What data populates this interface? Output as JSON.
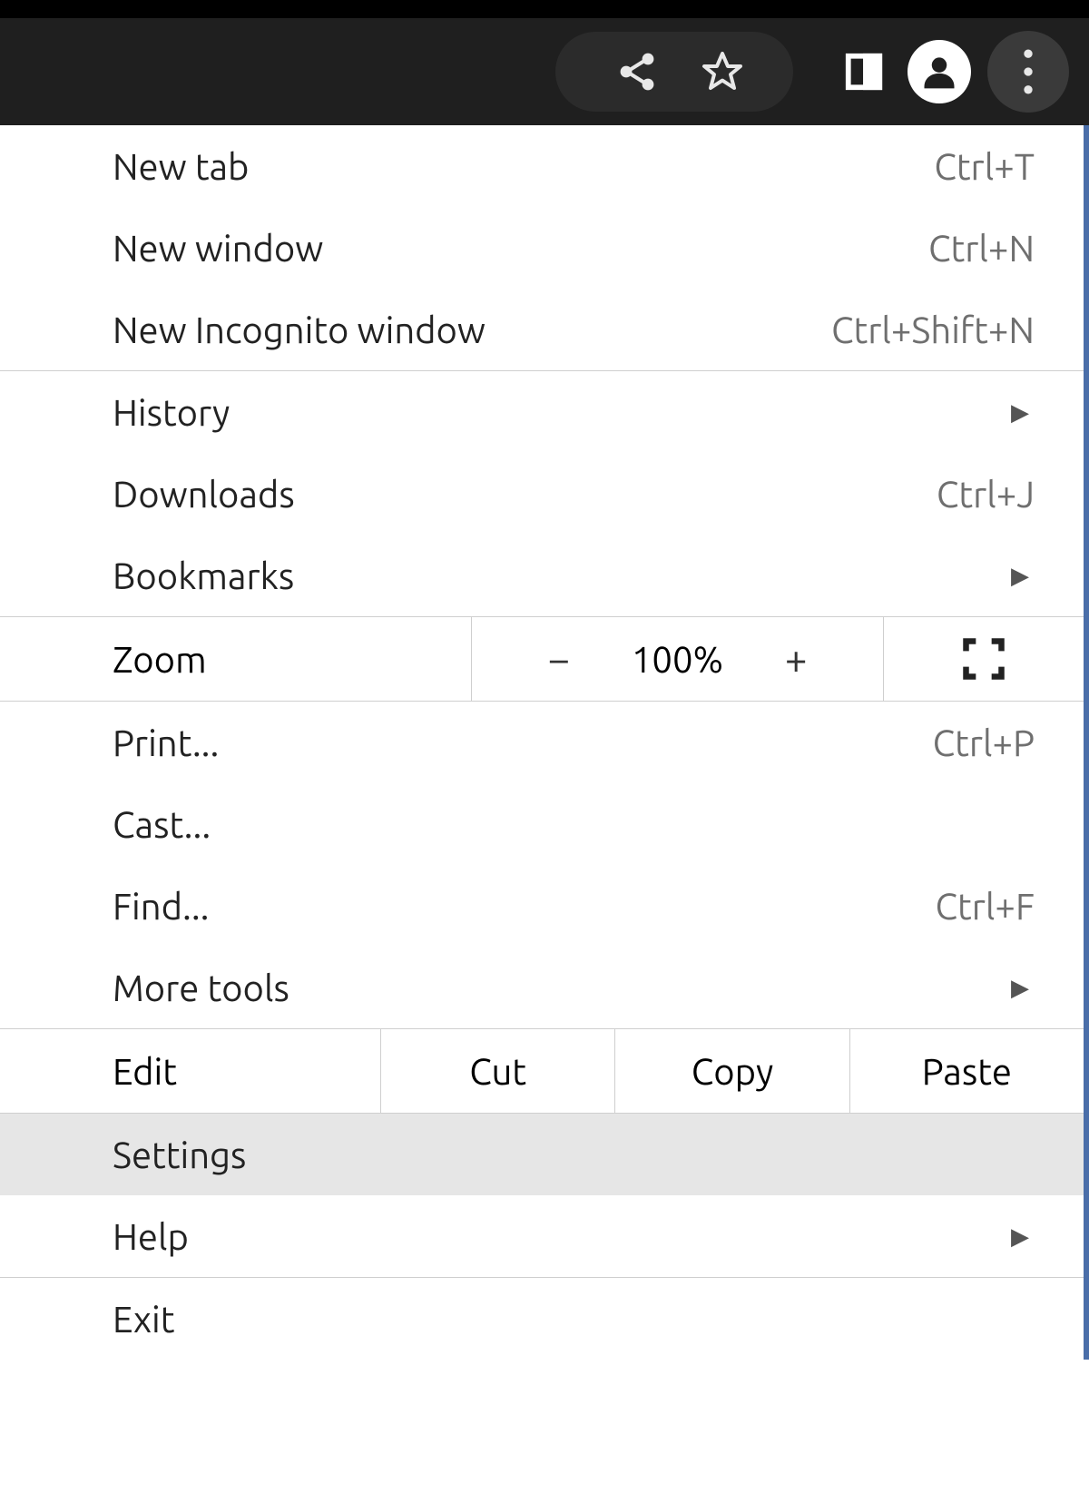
{
  "menu": {
    "new_tab": {
      "label": "New tab",
      "shortcut": "Ctrl+T"
    },
    "new_window": {
      "label": "New window",
      "shortcut": "Ctrl+N"
    },
    "new_incognito": {
      "label": "New Incognito window",
      "shortcut": "Ctrl+Shift+N"
    },
    "history": {
      "label": "History"
    },
    "downloads": {
      "label": "Downloads",
      "shortcut": "Ctrl+J"
    },
    "bookmarks": {
      "label": "Bookmarks"
    },
    "zoom": {
      "label": "Zoom",
      "value": "100%",
      "minus": "−",
      "plus": "+"
    },
    "print": {
      "label": "Print...",
      "shortcut": "Ctrl+P"
    },
    "cast": {
      "label": "Cast..."
    },
    "find": {
      "label": "Find...",
      "shortcut": "Ctrl+F"
    },
    "more_tools": {
      "label": "More tools"
    },
    "edit": {
      "label": "Edit",
      "cut": "Cut",
      "copy": "Copy",
      "paste": "Paste"
    },
    "settings": {
      "label": "Settings"
    },
    "help": {
      "label": "Help"
    },
    "exit": {
      "label": "Exit"
    }
  }
}
